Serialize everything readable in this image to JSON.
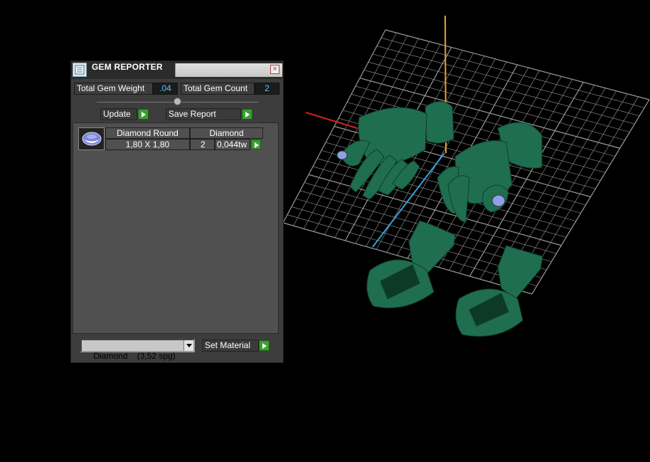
{
  "window": {
    "title": "GEM REPORTER"
  },
  "totals": {
    "weight_label": "Total Gem Weight",
    "weight_value": ".04",
    "count_label": "Total Gem Count",
    "count_value": "2"
  },
  "actions": {
    "update_label": "Update",
    "save_label": "Save Report"
  },
  "gem_list": [
    {
      "thumb_icon": "round-diamond-icon",
      "cut": "Diamond Round",
      "material": "Diamond",
      "size": "1,80 X 1,80",
      "count": "2",
      "weight": "0,044tw"
    }
  ],
  "footer": {
    "material_select_value": "Diamond    (3,52 spg)",
    "set_material_label": "Set Material"
  },
  "colors": {
    "gem_value_text": "#4ec9ff",
    "go_button": "#3aa02f",
    "model_color": "#1f6e4f",
    "grid_color": "#9a9a9a",
    "axis_x": "#d02020",
    "axis_y": "#3aa0d8",
    "axis_z": "#f0a030"
  }
}
